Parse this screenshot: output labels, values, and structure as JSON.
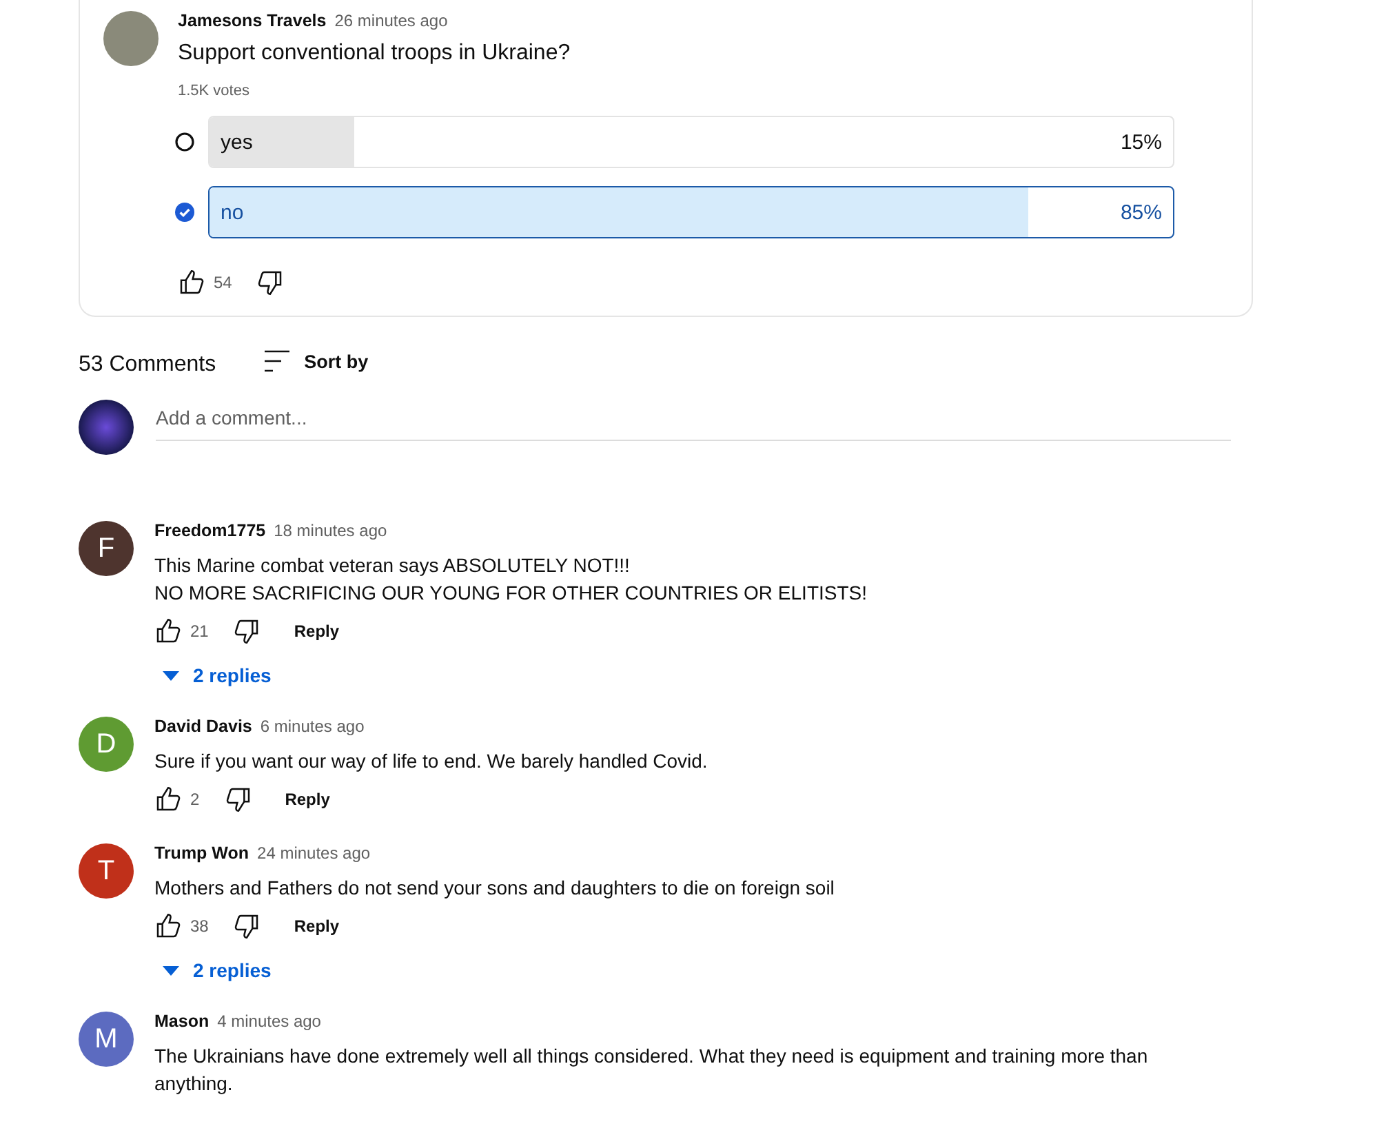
{
  "post": {
    "author": "Jamesons Travels",
    "time": "26 minutes ago",
    "question": "Support conventional troops in Ukraine?",
    "votes": "1.5K votes",
    "options": [
      {
        "label": "yes",
        "percent": "15%",
        "level": 0.15,
        "selected": false
      },
      {
        "label": "no",
        "percent": "85%",
        "level": 0.85,
        "selected": true
      }
    ],
    "likes": "54"
  },
  "comments_header": {
    "count": "53 Comments",
    "sort": "Sort by"
  },
  "add_comment": {
    "placeholder": "Add a comment..."
  },
  "comments": [
    {
      "author": "Freedom1775",
      "time": "18 minutes ago",
      "avatar_letter": "F",
      "color": "#4e342e",
      "lines": [
        "This Marine combat veteran says ABSOLUTELY NOT!!!",
        "NO MORE SACRIFICING OUR YOUNG FOR OTHER COUNTRIES OR ELITISTS!"
      ],
      "likes": "21",
      "reply": "Reply",
      "replies": "2 replies"
    },
    {
      "author": "David Davis",
      "time": "6 minutes ago",
      "avatar_letter": "D",
      "color": "#5f9b32",
      "lines": [
        "Sure if you want our way of life to end. We barely handled Covid."
      ],
      "likes": "2",
      "reply": "Reply"
    },
    {
      "author": "Trump Won",
      "time": "24 minutes ago",
      "avatar_letter": "T",
      "color": "#c0301a",
      "lines": [
        "Mothers and Fathers do not send your sons and daughters to die on foreign soil"
      ],
      "likes": "38",
      "reply": "Reply",
      "replies": "2 replies"
    },
    {
      "author": "Mason",
      "time": "4 minutes ago",
      "avatar_letter": "M",
      "color": "#5c6bc0",
      "lines": [
        "The Ukrainians have done extremely well all things considered. What they need is equipment and training more than anything."
      ]
    }
  ]
}
